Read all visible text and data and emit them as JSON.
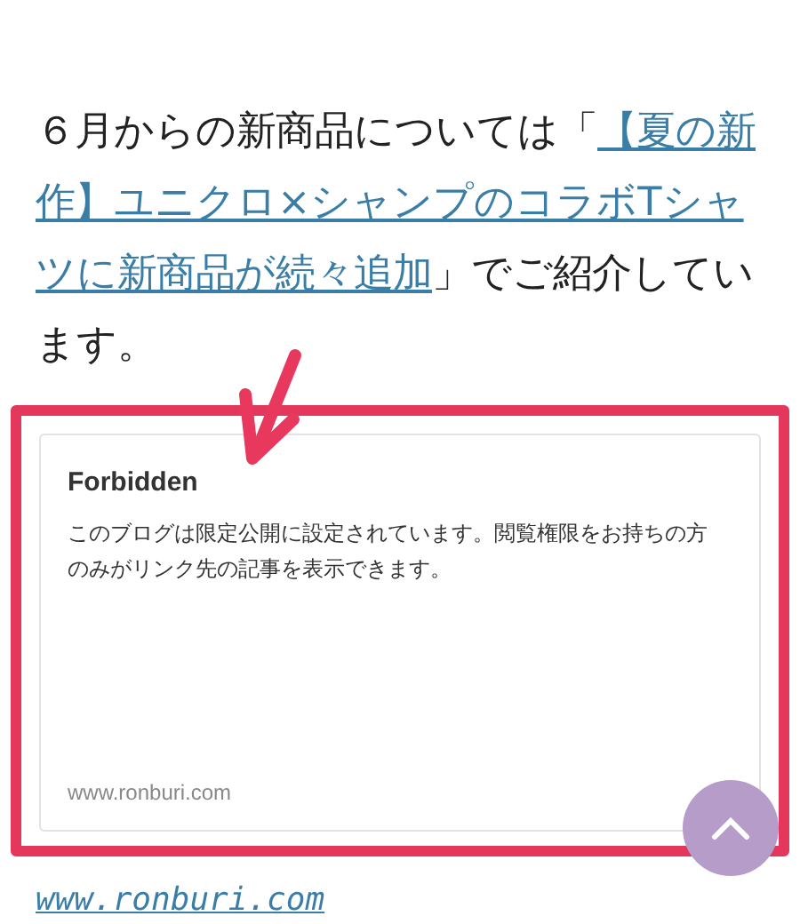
{
  "article": {
    "text_before": "６月からの新商品については「",
    "link_lines": [
      "【夏の新",
      "作】ユニクロ×シャンプのコラボTシャ",
      "ツに新商品が続々追加"
    ],
    "text_after": "」でご紹介しています。"
  },
  "embed_card": {
    "title": "Forbidden",
    "description": "このブログは限定公開に設定されています。閲覧権限をお持ちの方のみがリンク先の記事を表示できます。",
    "domain": "www.ronburi.com"
  },
  "footer_link": "www.ronburi.com"
}
